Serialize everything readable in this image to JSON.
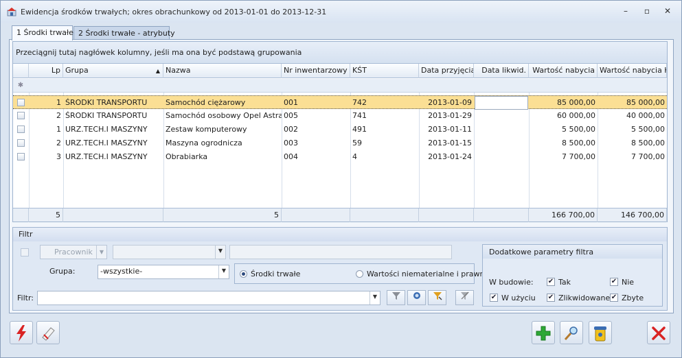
{
  "window": {
    "title": "Ewidencja środków trwałych; okres obrachunkowy od 2013-01-01 do 2013-12-31",
    "controls": {
      "minimize": "–",
      "restore": "▫",
      "close": "✕"
    }
  },
  "tabs": [
    {
      "label": "1 Środki trwałe",
      "active": true
    },
    {
      "label": "2 Środki trwałe - atrybuty",
      "active": false
    }
  ],
  "grid": {
    "group_hint": "Przeciągnij tutaj nagłówek kolumny, jeśli ma ona być podstawą grupowania",
    "columns": [
      "Lp",
      "Grupa",
      "Nazwa",
      "Nr inwentarzowy",
      "KŚT",
      "Data przyjęcia",
      "Data likwid.",
      "Wartość nabycia",
      "Wartość nabycia K"
    ],
    "rows": [
      {
        "lp": "1",
        "grupa": "ŚRODKI TRANSPORTU",
        "nazwa": "Samochód ciężarowy",
        "nr": "001",
        "kst": "742",
        "data_przyjecia": "2013-01-09",
        "data_likwid": "",
        "wartosc": "85 000,00",
        "wartosc_k": "85 000,00"
      },
      {
        "lp": "2",
        "grupa": "ŚRODKI TRANSPORTU",
        "nazwa": "Samochód osobowy Opel Astra",
        "nr": "005",
        "kst": "741",
        "data_przyjecia": "2013-01-29",
        "data_likwid": "",
        "wartosc": "60 000,00",
        "wartosc_k": "40 000,00"
      },
      {
        "lp": "1",
        "grupa": "URZ.TECH.I MASZYNY",
        "nazwa": "Zestaw komputerowy",
        "nr": "002",
        "kst": "491",
        "data_przyjecia": "2013-01-11",
        "data_likwid": "",
        "wartosc": "5 500,00",
        "wartosc_k": "5 500,00"
      },
      {
        "lp": "2",
        "grupa": "URZ.TECH.I MASZYNY",
        "nazwa": "Maszyna ogrodnicza",
        "nr": "003",
        "kst": "59",
        "data_przyjecia": "2013-01-15",
        "data_likwid": "",
        "wartosc": "8 500,00",
        "wartosc_k": "8 500,00"
      },
      {
        "lp": "3",
        "grupa": "URZ.TECH.I MASZYNY",
        "nazwa": "Obrabiarka",
        "nr": "004",
        "kst": "4",
        "data_przyjecia": "2013-01-24",
        "data_likwid": "",
        "wartosc": "7 700,00",
        "wartosc_k": "7 700,00"
      }
    ],
    "footer": {
      "lp_count": "5",
      "nazwa_count": "5",
      "wartosc_sum": "166 700,00",
      "wartosc_k_sum": "146 700,00"
    }
  },
  "filter": {
    "title": "Filtr",
    "pracownik_button": "Pracownik",
    "grupa_label": "Grupa:",
    "grupa_value": "-wszystkie-",
    "radio_srodki": "Środki trwałe",
    "radio_wartosci": "Wartości niematerialne i prawne",
    "filtr_label": "Filtr:",
    "filtr_value": ""
  },
  "params": {
    "title": "Dodatkowe parametry filtra",
    "w_budowie_label": "W budowie:",
    "tak": "Tak",
    "nie": "Nie",
    "w_uzyciu": "W użyciu",
    "zlikwidowane": "Zlikwidowane",
    "zbyte": "Zbyte"
  },
  "colors": {
    "selected_row": "#fbdf94",
    "accent": "#2c4a7e"
  }
}
